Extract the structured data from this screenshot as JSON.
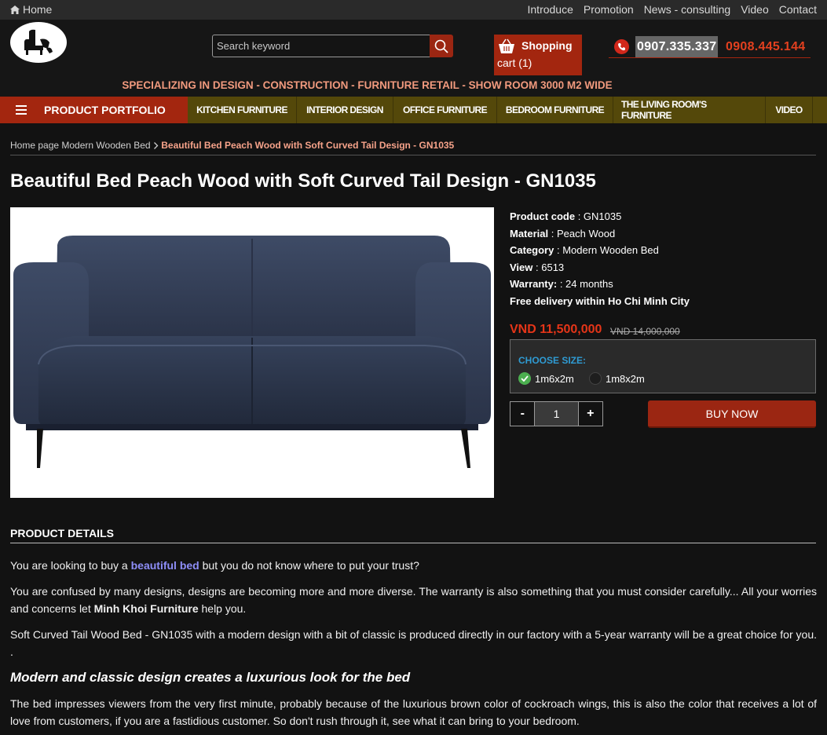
{
  "topbar": {
    "home_label": "Home",
    "links": [
      "Introduce",
      "Promotion",
      "News - consulting",
      "Video",
      "Contact"
    ]
  },
  "header": {
    "search_placeholder": "Search keyword",
    "cart_line1": "Shopping",
    "cart_line2": "cart (1)",
    "phone1": "0907.335.337",
    "phone2": "0908.445.144",
    "slogan": "SPECIALIZING IN DESIGN - CONSTRUCTION - FURNITURE RETAIL - SHOW ROOM 3000 M2 WIDE"
  },
  "nav": {
    "portfolio_label": "PRODUCT PORTFOLIO",
    "items": [
      "KITCHEN FURNITURE",
      "INTERIOR DESIGN",
      "OFFICE FURNITURE",
      "BEDROOM FURNITURE",
      "THE LIVING ROOM'S FURNITURE",
      "VIDEO"
    ]
  },
  "breadcrumb": {
    "home": "Home page",
    "category": "Modern Wooden Bed",
    "current": "Beautiful Bed Peach Wood with Soft Curved Tail Design - GN1035"
  },
  "product": {
    "title": "Beautiful Bed Peach Wood with Soft Curved Tail Design - GN1035",
    "code_label": "Product code",
    "code": "GN1035",
    "material_label": "Material",
    "material": "Peach Wood",
    "category_label": "Category",
    "category": "Modern Wooden Bed",
    "view_label": "View",
    "view": "6513",
    "warranty_label": "Warranty:",
    "warranty": "24 months",
    "delivery": "Free delivery within Ho Chi Minh City",
    "price": "VND 11,500,000",
    "old_price": "VND 14,000,000",
    "size_label": "CHOOSE SIZE:",
    "sizes": [
      "1m6x2m",
      "1m8x2m"
    ],
    "quantity": "1",
    "minus": "-",
    "plus": "+",
    "buy_label": "BUY NOW"
  },
  "details": {
    "heading": "PRODUCT DETAILS",
    "p1_a": "You are looking to buy a ",
    "p1_link": "beautiful bed",
    "p1_b": " but you do not know where to put your trust?",
    "p2_a": "You are confused by many designs, designs are becoming more and more diverse. The warranty is also something that you must consider carefully... All your worries and concerns let ",
    "p2_bold": "Minh Khoi Furniture",
    "p2_b": " help you.",
    "p3": "Soft Curved Tail Wood Bed - GN1035 with a modern design with a bit of classic is produced directly in our factory with a 5-year warranty will be a great choice for you. .",
    "subheading": "Modern and classic design creates a luxurious look for the bed",
    "p4": "The bed impresses viewers from the very first minute, probably because of the luxurious brown color of cockroach wings, this is also the color that receives a lot of love from customers, if you are a fastidious customer. So don't rush through it, see what it can bring to your bedroom."
  }
}
